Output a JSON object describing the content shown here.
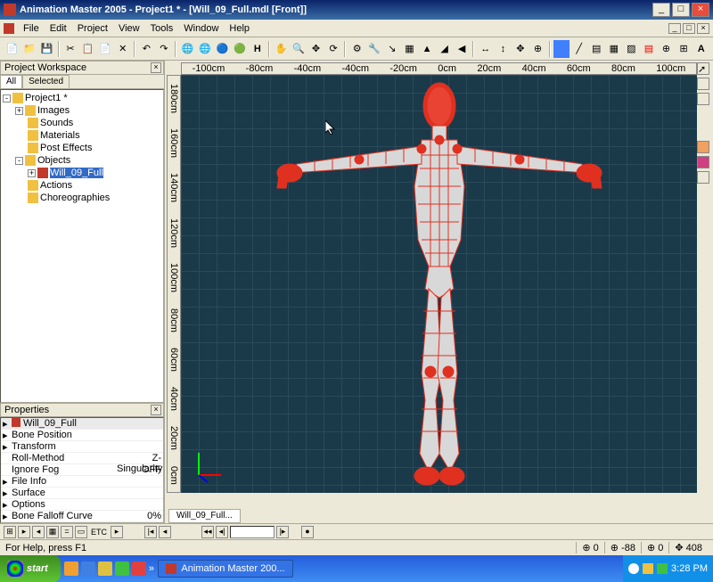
{
  "title": "Animation Master 2005 - Project1 * - [Will_09_Full.mdl [Front]]",
  "menu": [
    "File",
    "Edit",
    "Project",
    "View",
    "Tools",
    "Window",
    "Help"
  ],
  "workspace_header": "Project Workspace",
  "tabs": {
    "all": "All",
    "sel": "Selected"
  },
  "tree": {
    "root": "Project1 *",
    "items": [
      "Images",
      "Sounds",
      "Materials",
      "Post Effects",
      "Objects",
      "Actions",
      "Choreographies"
    ],
    "object_selected": "Will_09_Full"
  },
  "props_header": "Properties",
  "props": {
    "name": "Will_09_Full",
    "rows": [
      {
        "n": "Bone Position",
        "v": ""
      },
      {
        "n": "Transform",
        "v": ""
      },
      {
        "n": "Roll-Method",
        "v": "Z-Singularity"
      },
      {
        "n": "Ignore Fog",
        "v": "OFF"
      },
      {
        "n": "File Info",
        "v": ""
      },
      {
        "n": "Surface",
        "v": ""
      },
      {
        "n": "Options",
        "v": ""
      },
      {
        "n": "Bone Falloff Curve",
        "v": "0%"
      }
    ]
  },
  "ruler_h": [
    "-100cm",
    "-80cm",
    "-40cm",
    "-40cm",
    "-20cm",
    "0cm",
    "20cm",
    "40cm",
    "60cm",
    "80cm",
    "100cm"
  ],
  "ruler_v": [
    "180cm",
    "160cm",
    "140cm",
    "120cm",
    "100cm",
    "80cm",
    "60cm",
    "40cm",
    "20cm",
    "0cm"
  ],
  "viewtab": "Will_09_Full...",
  "status": {
    "help": "For Help, press F1",
    "v1": "0",
    "v2": "-88",
    "v3": "0",
    "v4": "408"
  },
  "taskbar": {
    "start": "start",
    "app": "Animation Master 200...",
    "time": "3:28 PM"
  }
}
